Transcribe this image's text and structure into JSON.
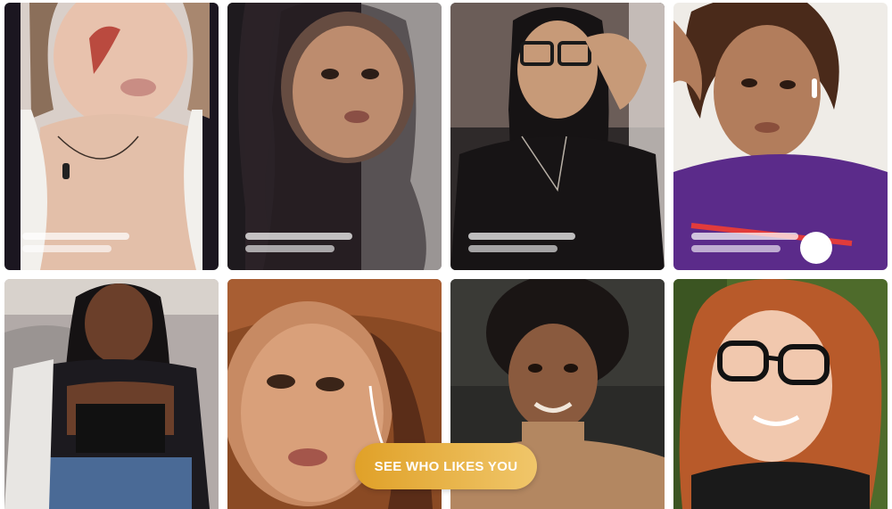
{
  "cta": {
    "label": "SEE WHO LIKES YOU",
    "gradient_start": "#E0A128",
    "gradient_end": "#F0C66A"
  },
  "cards": [
    {
      "row": 1,
      "palette": [
        "#3a2f3a",
        "#e7c3b0",
        "#d8a48f",
        "#f1efe9",
        "#b2352c"
      ],
      "has_placeholder_bars": true
    },
    {
      "row": 1,
      "palette": [
        "#2a2227",
        "#b8876a",
        "#1e1a1e",
        "#7d5a49",
        "#e6e2dd"
      ],
      "has_placeholder_bars": true
    },
    {
      "row": 1,
      "palette": [
        "#2f2a2a",
        "#c79a78",
        "#161314",
        "#e9e4df",
        "#8c6f5d"
      ],
      "has_placeholder_bars": true
    },
    {
      "row": 1,
      "palette": [
        "#f0ede8",
        "#b27d5c",
        "#4a2a1a",
        "#5b2b8a",
        "#d6c4b5"
      ],
      "has_placeholder_bars": true
    },
    {
      "row": 2,
      "palette": [
        "#b2aaa8",
        "#6b3f2a",
        "#151213",
        "#1c1a1f",
        "#4a6a96"
      ],
      "has_placeholder_bars": false
    },
    {
      "row": 2,
      "palette": [
        "#8a4a24",
        "#c78a63",
        "#e6b18c",
        "#4a2a1a",
        "#f3e4d8"
      ],
      "has_placeholder_bars": false
    },
    {
      "row": 2,
      "palette": [
        "#2a2a28",
        "#8a5a3e",
        "#1a1514",
        "#b38761",
        "#d3b18d"
      ],
      "has_placeholder_bars": false
    },
    {
      "row": 2,
      "palette": [
        "#4e6b2b",
        "#d08150",
        "#f1c8ae",
        "#1a1a1a",
        "#b85a2a"
      ],
      "has_placeholder_bars": false
    }
  ]
}
